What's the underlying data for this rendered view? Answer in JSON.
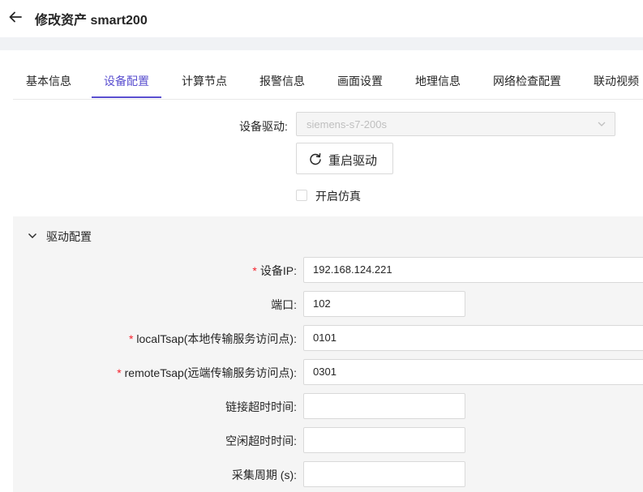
{
  "header": {
    "title": "修改资产 smart200"
  },
  "tabs": [
    {
      "label": "基本信息"
    },
    {
      "label": "设备配置"
    },
    {
      "label": "计算节点"
    },
    {
      "label": "报警信息"
    },
    {
      "label": "画面设置"
    },
    {
      "label": "地理信息"
    },
    {
      "label": "网络检查配置"
    },
    {
      "label": "联动视频"
    }
  ],
  "active_tab": "设备配置",
  "device": {
    "driver_label": "设备驱动:",
    "driver_value": "siemens-s7-200s",
    "restart_label": "重启驱动",
    "simulate_label": "开启仿真",
    "simulate_checked": false
  },
  "panel": {
    "title": "驱动配置",
    "fields": {
      "ip": {
        "required": "*",
        "label": "设备IP:",
        "value": "192.168.124.221"
      },
      "port": {
        "label": "端口:",
        "value": "102"
      },
      "local_tsap": {
        "required": "*",
        "label": "localTsap(本地传输服务访问点):",
        "value": "0101"
      },
      "remote_tsap": {
        "required": "*",
        "label": "remoteTsap(远端传输服务访问点):",
        "value": "0301"
      },
      "link_timeout": {
        "label": "链接超时时间:",
        "value": ""
      },
      "idle_timeout": {
        "label": "空闲超时时间:",
        "value": ""
      },
      "period": {
        "label": "采集周期 (s):",
        "value": ""
      }
    }
  },
  "colors": {
    "accent": "#5a4fcf",
    "required": "#f5222d",
    "panel_bg": "#f5f5f5"
  },
  "icons": {
    "back": "arrow-left-icon",
    "dropdown": "chevron-down-icon",
    "restart": "reload-icon",
    "collapse": "chevron-down-icon"
  }
}
